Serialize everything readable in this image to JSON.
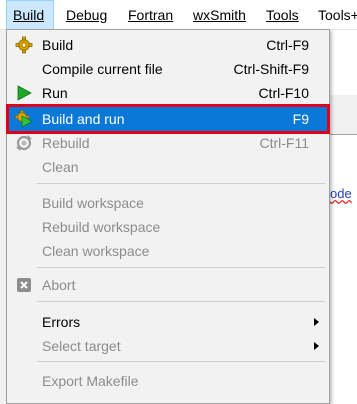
{
  "menubar": {
    "items": [
      {
        "label": "Build",
        "active": true
      },
      {
        "label": "Debug"
      },
      {
        "label": "Fortran"
      },
      {
        "label": "wxSmith"
      },
      {
        "label": "Tools"
      },
      {
        "label": "Tools+"
      }
    ]
  },
  "background": {
    "code_fragment": "ode"
  },
  "build_menu": {
    "items": [
      {
        "label": "Build",
        "shortcut": "Ctrl-F9",
        "icon": "gear-icon",
        "enabled": true
      },
      {
        "label": "Compile current file",
        "shortcut": "Ctrl-Shift-F9",
        "enabled": true
      },
      {
        "label": "Run",
        "shortcut": "Ctrl-F10",
        "icon": "play-icon",
        "enabled": true
      },
      {
        "label": "Build and run",
        "shortcut": "F9",
        "icon": "gear-play-icon",
        "enabled": true,
        "highlighted": true
      },
      {
        "label": "Rebuild",
        "shortcut": "Ctrl-F11",
        "icon": "rebuild-icon",
        "enabled": false
      },
      {
        "label": "Clean",
        "enabled": false
      },
      {
        "label": "Build workspace",
        "enabled": false
      },
      {
        "label": "Rebuild workspace",
        "enabled": false
      },
      {
        "label": "Clean workspace",
        "enabled": false
      },
      {
        "label": "Abort",
        "icon": "abort-icon",
        "enabled": false
      },
      {
        "label": "Errors",
        "submenu": true,
        "enabled": true
      },
      {
        "label": "Select target",
        "submenu": true,
        "enabled": false
      },
      {
        "label": "Export Makefile",
        "enabled": false
      }
    ]
  },
  "colors": {
    "highlight": "#0a78d7",
    "highlight_border": "#e0001a",
    "menubar_active": "#cce8ff",
    "disabled_text": "#8c8c8c"
  }
}
